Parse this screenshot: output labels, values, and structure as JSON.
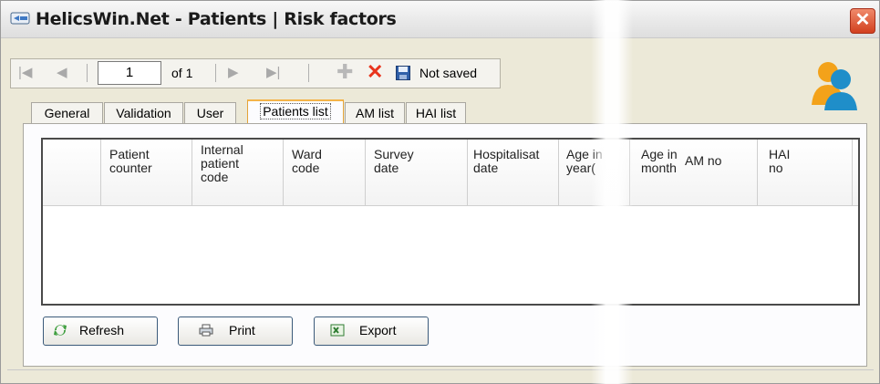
{
  "window": {
    "title": "HelicsWin.Net - Patients  |  Risk factors",
    "close_label": "✕"
  },
  "navigator": {
    "position": "1",
    "of_label": "of 1",
    "status": "Not saved"
  },
  "tabs": [
    {
      "label": "General"
    },
    {
      "label": "Validation"
    },
    {
      "label": "User"
    },
    {
      "label": "Patients list"
    },
    {
      "label": "AM list"
    },
    {
      "label": "HAI list"
    }
  ],
  "active_tab": "Patients list",
  "grid": {
    "columns": [
      {
        "label": ""
      },
      {
        "label": "Patient counter"
      },
      {
        "label": "Internal patient code"
      },
      {
        "label": "Ward code"
      },
      {
        "label": "Survey date"
      },
      {
        "label": "Hospitalisat date"
      },
      {
        "label": "Age in year("
      },
      {
        "label": "Age in month"
      },
      {
        "label": "AM no"
      },
      {
        "label": "HAI no"
      }
    ],
    "rows": []
  },
  "buttons": {
    "refresh": "Refresh",
    "print": "Print",
    "export": "Export"
  },
  "icons": {
    "title": "helicswin-app-icon",
    "first": "first-record-icon",
    "prev": "previous-record-icon",
    "next": "next-record-icon",
    "last": "last-record-icon",
    "add": "add-record-icon",
    "delete": "delete-record-icon",
    "save": "save-icon",
    "users": "patients-users-icon"
  },
  "colors": {
    "close": "#d2401f",
    "delete": "#e8341c",
    "active_tab": "#f4b449"
  }
}
